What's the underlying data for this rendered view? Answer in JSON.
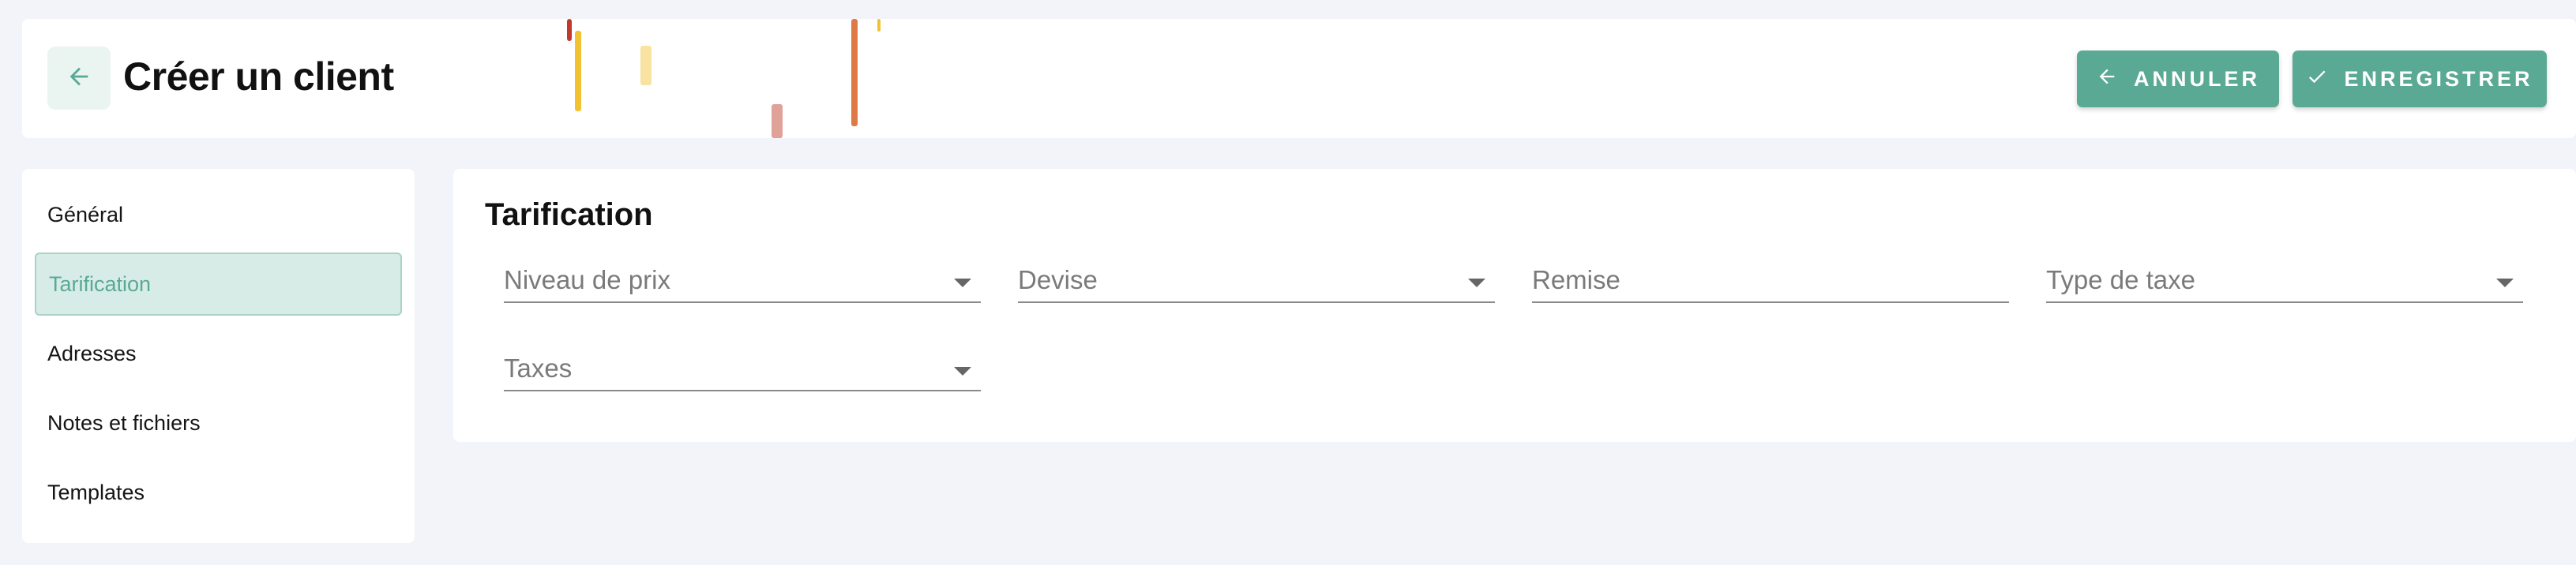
{
  "colors": {
    "accent": "#5aa994",
    "accent_light": "#d7ece6",
    "background": "#f3f4f9"
  },
  "header": {
    "title": "Créer un client",
    "back_icon": "arrow-left-icon",
    "cancel_label": "ANNULER",
    "cancel_icon": "arrow-left-icon",
    "save_label": "ENREGISTRER",
    "save_icon": "check-icon"
  },
  "sidebar": {
    "active": "Tarification",
    "items": [
      {
        "label": "Général"
      },
      {
        "label": "Tarification"
      },
      {
        "label": "Adresses"
      },
      {
        "label": "Notes et fichiers"
      },
      {
        "label": "Templates"
      }
    ]
  },
  "main": {
    "section_title": "Tarification",
    "fields": [
      {
        "label": "Niveau de prix",
        "type": "select",
        "value": ""
      },
      {
        "label": "Devise",
        "type": "select",
        "value": ""
      },
      {
        "label": "Remise",
        "type": "text",
        "value": ""
      },
      {
        "label": "Type de taxe",
        "type": "select",
        "value": ""
      },
      {
        "label": "Taxes",
        "type": "select",
        "value": ""
      }
    ]
  }
}
